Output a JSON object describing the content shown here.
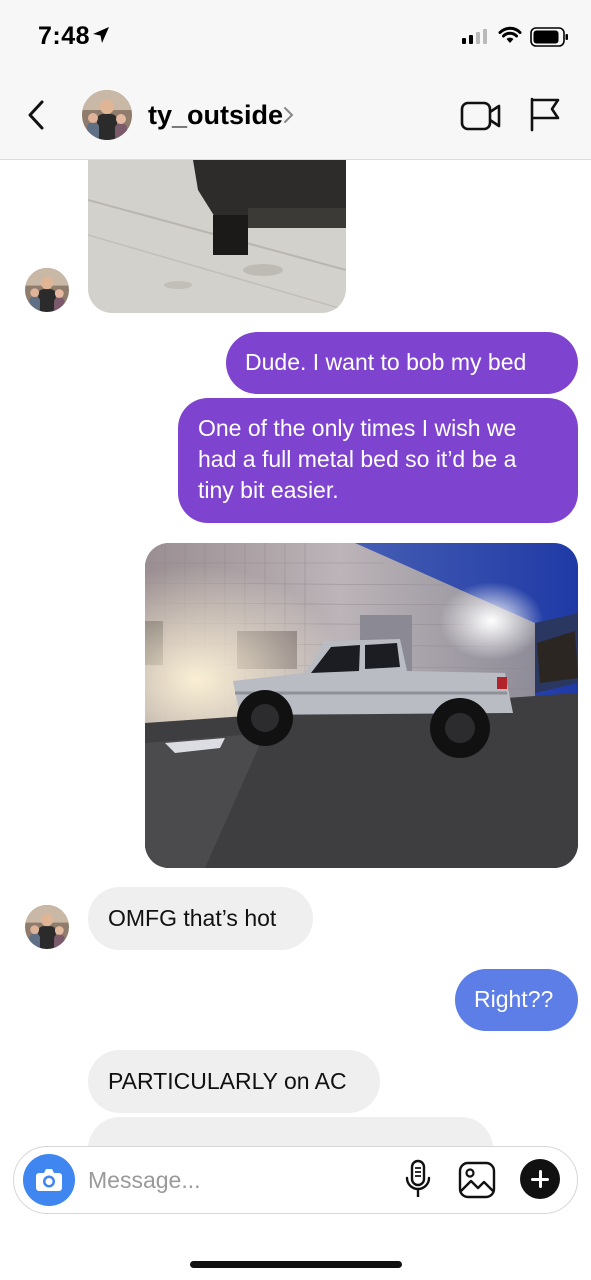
{
  "status_bar": {
    "time": "7:48"
  },
  "header": {
    "username": "ty_outside"
  },
  "thread": {
    "messages": [
      {
        "text": "Dude. I want to bob my bed"
      },
      {
        "text_lines": [
          "One of the only times I wish we",
          "had a full metal bed so it’d be a",
          "tiny bit easier."
        ]
      },
      {
        "text": "OMFG that’s hot"
      },
      {
        "text": "Right??"
      },
      {
        "text": "PARTICULARLY on AC"
      }
    ]
  },
  "composer": {
    "placeholder": "Message..."
  },
  "colors": {
    "sent_bubble": "#7f44cf",
    "sent_bubble_latest": "#5c7ee6",
    "received_bubble": "#efefef",
    "camera_button": "#3f86f0"
  },
  "icons": [
    "location-arrow-icon",
    "signal-icon",
    "wifi-icon",
    "battery-icon",
    "back-chevron-icon",
    "chevron-right-icon",
    "video-call-icon",
    "flag-icon",
    "camera-icon",
    "microphone-icon",
    "gallery-icon",
    "plus-icon"
  ]
}
